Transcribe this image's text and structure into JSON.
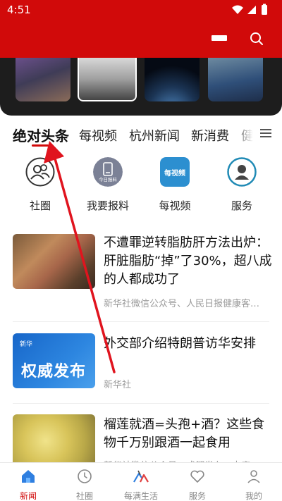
{
  "status_bar": {
    "time": "4:51"
  },
  "tabs": [
    {
      "label": "绝对头条"
    },
    {
      "label": "每视频"
    },
    {
      "label": "杭州新闻"
    },
    {
      "label": "新消费"
    },
    {
      "label": "健"
    }
  ],
  "quick_links": [
    {
      "label": "社圈",
      "icon": "people-icon"
    },
    {
      "label": "我要报料",
      "icon": "report-icon"
    },
    {
      "label": "每视频",
      "icon": "video-logo-icon"
    },
    {
      "label": "服务",
      "icon": "service-agent-icon"
    }
  ],
  "quick_icon_texts": {
    "report": "今日报料",
    "video": "每视频"
  },
  "news": [
    {
      "title": "不遭罪逆转脂肪肝方法出炉：肝脏脂肪“掉”了30%，超八成的人都成功了",
      "meta": "新华社微信公众号、人民日报健康客…"
    },
    {
      "title": "外交部介绍特朗普访华安排",
      "meta": "新华社",
      "image_text": "权威发布",
      "image_badge": "新华"
    },
    {
      "title": "榴莲就酒=头孢+酒？这些食物千万别跟酒一起食用",
      "meta": "新华社微信公众号、成都发布、中店"
    }
  ],
  "bottom_nav": [
    {
      "label": "新闻",
      "icon": "home-icon",
      "active": true
    },
    {
      "label": "社圈",
      "icon": "clock-icon",
      "active": false
    },
    {
      "label": "每满生活",
      "icon": "mountain-logo-icon",
      "active": false
    },
    {
      "label": "服务",
      "icon": "heart-icon",
      "active": false
    },
    {
      "label": "我的",
      "icon": "user-icon",
      "active": false
    }
  ],
  "colors": {
    "brand_red": "#d10a0a",
    "annotation_arrow": "#e0141e"
  }
}
